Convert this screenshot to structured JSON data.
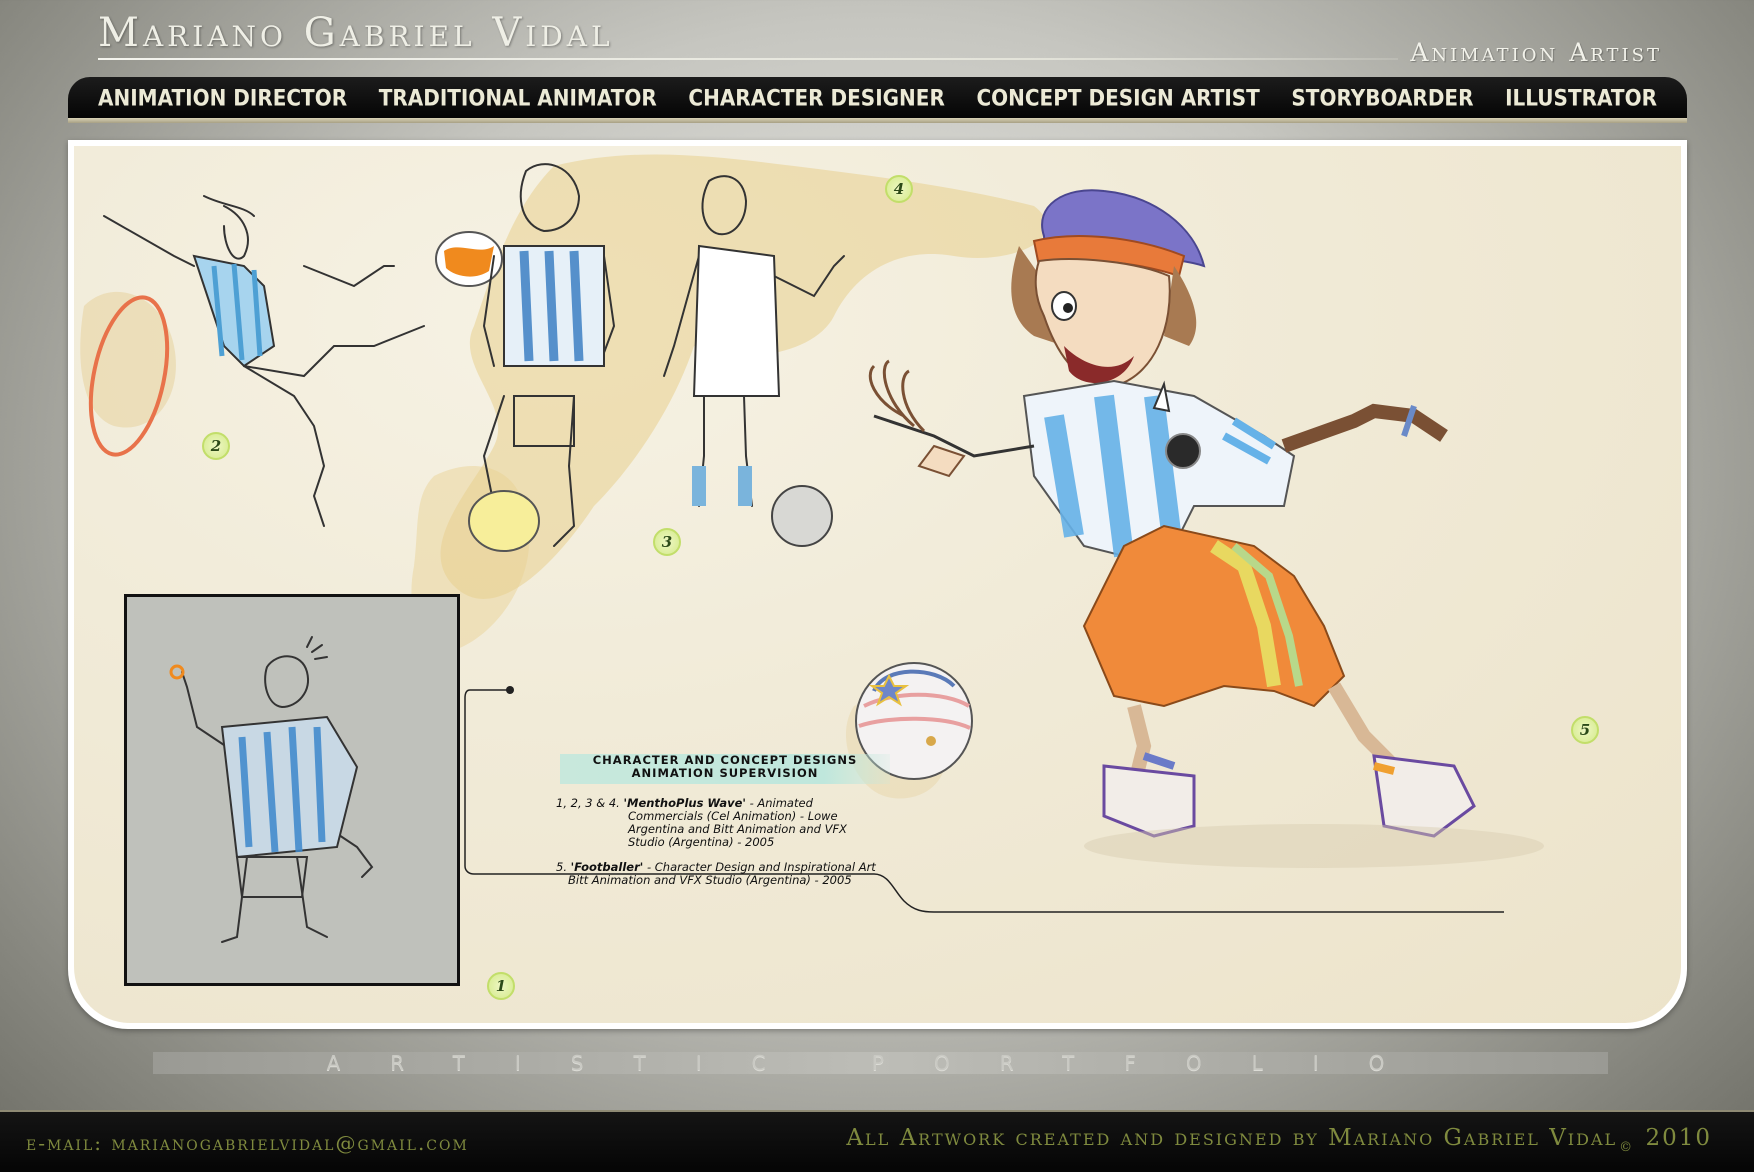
{
  "header": {
    "name": "Mariano Gabriel Vidal",
    "role": "Animation Artist"
  },
  "nav": {
    "items": [
      {
        "label": "Animation Director"
      },
      {
        "label": "Traditional Animator"
      },
      {
        "label": "Character Designer"
      },
      {
        "label": "Concept Design Artist"
      },
      {
        "label": "Storyboarder"
      },
      {
        "label": "Illustrator"
      }
    ]
  },
  "artwork": {
    "badges": [
      "1",
      "2",
      "3",
      "4",
      "5"
    ],
    "caption": {
      "heading_line1": "CHARACTER AND CONCEPT DESIGNS",
      "heading_line2": "ANIMATION SUPERVISION",
      "entry1_prefix": "1, 2, 3 & 4. ",
      "entry1_title": "'MenthoPlus Wave'",
      "entry1_text": " - Animated",
      "entry1_line2": "Commercials (Cel Animation) - Lowe",
      "entry1_line3": "Argentina and Bitt Animation and VFX",
      "entry1_line4": "Studio (Argentina) - 2005",
      "entry2_prefix": "5. ",
      "entry2_title": "'Footballer'",
      "entry2_text": " - Character Design and Inspirational Art",
      "entry2_line2": "Bitt Animation and VFX Studio (Argentina) - 2005"
    }
  },
  "portfolio_band": "Artistic Portfolio",
  "footer": {
    "email": "e-mail: marianogabrielvidal@gmail.com",
    "credit": "All Artwork created and designed by Mariano Gabriel Vidal",
    "copyright": "©",
    "year": "2010"
  },
  "colors": {
    "nav_bg": "#050505",
    "nav_text": "#ecead6",
    "footer_text": "#7f8a3e",
    "paper": "#f1ebd8",
    "badge": "#d4ea8a"
  }
}
